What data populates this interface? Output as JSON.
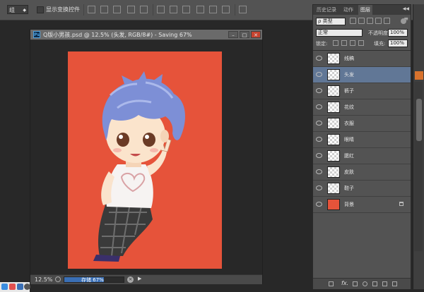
{
  "options_bar": {
    "auto_select_value": "组",
    "show_transform_label": "显示变换控件"
  },
  "document": {
    "ps_badge": "Ps",
    "title": "Q版小男孩.psd @ 12.5% (头发, RGB/8#) - Saving 67%",
    "zoom": "12.5%",
    "save_status": "存储",
    "save_percent": "67%",
    "save_progress": 0.67,
    "canvas_color": "#e6533a"
  },
  "panel": {
    "tabs": [
      "历史记录",
      "动作",
      "图层"
    ],
    "active_tab": "图层",
    "filter_type": "类型",
    "blend_mode": "正常",
    "opacity_label": "不透明度:",
    "opacity_value": "100%",
    "lock_label": "锁定:",
    "fill_label": "填充:",
    "fill_value": "100%",
    "fx_label": "fx.",
    "layers": [
      {
        "name": "线稿",
        "selected": false
      },
      {
        "name": "头发",
        "selected": true
      },
      {
        "name": "裤子",
        "selected": false
      },
      {
        "name": "花纹",
        "selected": false
      },
      {
        "name": "衣服",
        "selected": false
      },
      {
        "name": "眼睛",
        "selected": false
      },
      {
        "name": "腮红",
        "selected": false
      },
      {
        "name": "皮肤",
        "selected": false
      },
      {
        "name": "鞋子",
        "selected": false
      },
      {
        "name": "背景",
        "selected": false,
        "locked": true
      }
    ]
  },
  "colors": {
    "accent_selection": "#617796",
    "progress_blue": "#3a6fb5",
    "background_layer": "#e6533a"
  }
}
